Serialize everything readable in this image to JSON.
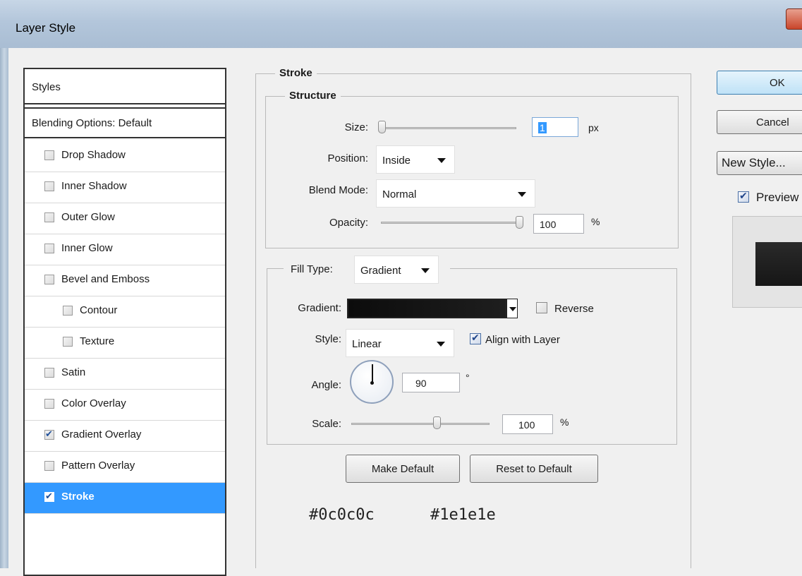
{
  "window": {
    "title": "Layer Style"
  },
  "styles_panel": {
    "header": "Styles",
    "blending_options": "Blending Options: Default",
    "items": [
      {
        "label": "Drop Shadow",
        "checked": false,
        "indent": false,
        "selected": false
      },
      {
        "label": "Inner Shadow",
        "checked": false,
        "indent": false,
        "selected": false
      },
      {
        "label": "Outer Glow",
        "checked": false,
        "indent": false,
        "selected": false
      },
      {
        "label": "Inner Glow",
        "checked": false,
        "indent": false,
        "selected": false
      },
      {
        "label": "Bevel and Emboss",
        "checked": false,
        "indent": false,
        "selected": false
      },
      {
        "label": "Contour",
        "checked": false,
        "indent": true,
        "selected": false
      },
      {
        "label": "Texture",
        "checked": false,
        "indent": true,
        "selected": false
      },
      {
        "label": "Satin",
        "checked": false,
        "indent": false,
        "selected": false
      },
      {
        "label": "Color Overlay",
        "checked": false,
        "indent": false,
        "selected": false
      },
      {
        "label": "Gradient Overlay",
        "checked": true,
        "indent": false,
        "selected": false
      },
      {
        "label": "Pattern Overlay",
        "checked": false,
        "indent": false,
        "selected": false
      },
      {
        "label": "Stroke",
        "checked": true,
        "indent": false,
        "selected": true
      }
    ]
  },
  "stroke": {
    "title": "Stroke",
    "structure": {
      "title": "Structure",
      "size_label": "Size:",
      "size_value": "1",
      "size_unit": "px",
      "position_label": "Position:",
      "position_value": "Inside",
      "blend_mode_label": "Blend Mode:",
      "blend_mode_value": "Normal",
      "opacity_label": "Opacity:",
      "opacity_value": "100",
      "opacity_unit": "%"
    },
    "fill": {
      "fill_type_label": "Fill Type:",
      "fill_type_value": "Gradient",
      "gradient_label": "Gradient:",
      "reverse_label": "Reverse",
      "reverse_checked": false,
      "style_label": "Style:",
      "style_value": "Linear",
      "align_label": "Align with Layer",
      "align_checked": true,
      "angle_label": "Angle:",
      "angle_value": "90",
      "angle_unit": "°",
      "scale_label": "Scale:",
      "scale_value": "100",
      "scale_unit": "%"
    },
    "make_default_label": "Make Default",
    "reset_default_label": "Reset to Default"
  },
  "gradient_colors": {
    "start": "#0c0c0c",
    "end": "#1e1e1e"
  },
  "annotations": {
    "color1": "#0c0c0c",
    "color2": "#1e1e1e"
  },
  "buttons": {
    "ok": "OK",
    "cancel": "Cancel",
    "new_style": "New Style...",
    "preview_label": "Preview",
    "preview_checked": true
  },
  "colors": {
    "selection": "#3399ff",
    "ok_border": "#3c7fb1"
  }
}
